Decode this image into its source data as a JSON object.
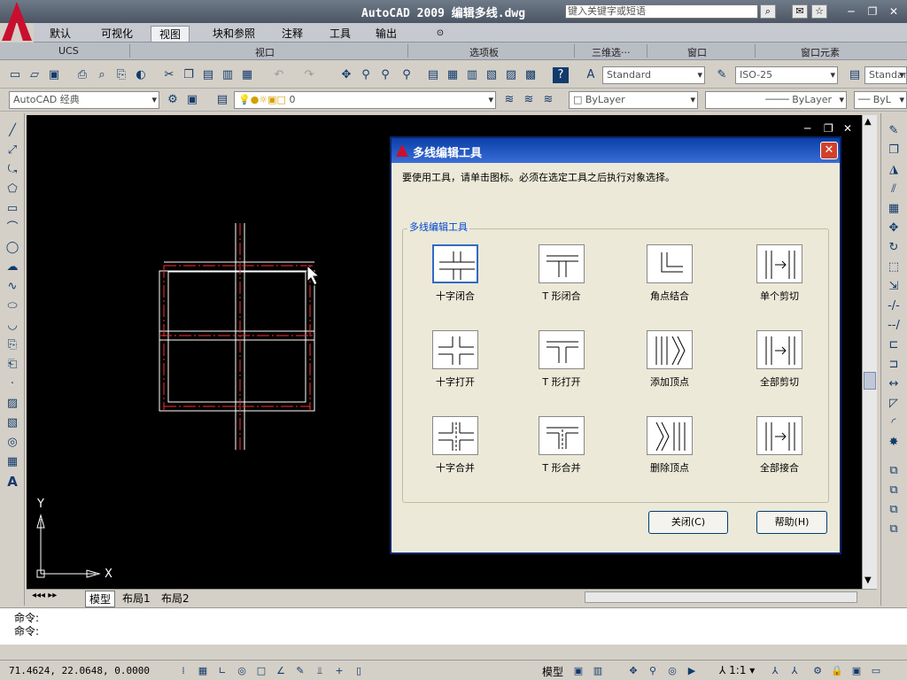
{
  "app": {
    "title": "AutoCAD 2009  编辑多线.dwg",
    "search_placeholder": "键入关键字或短语"
  },
  "ribbon": {
    "tabs": [
      {
        "label": "默认"
      },
      {
        "label": "可视化"
      },
      {
        "label": "视图"
      },
      {
        "label": "块和参照"
      },
      {
        "label": "注释"
      },
      {
        "label": "工具"
      },
      {
        "label": "输出"
      }
    ],
    "active_tab": "视图",
    "panels": [
      {
        "label": "UCS"
      },
      {
        "label": "视口"
      },
      {
        "label": "选项板"
      },
      {
        "label": "三维选···"
      },
      {
        "label": "窗口"
      },
      {
        "label": "窗口元素"
      }
    ]
  },
  "toolbar": {
    "text_style": "Standard",
    "dim_style": "ISO-25",
    "table_style": "Standar",
    "workspace": "AutoCAD 经典",
    "layer": "0",
    "color": "ByLayer",
    "linetype": "ByLayer",
    "lineweight": "ByL"
  },
  "canvas": {
    "ucs_x": "X",
    "ucs_y": "Y"
  },
  "layout_tabs": [
    {
      "label": "模型"
    },
    {
      "label": "布局1"
    },
    {
      "label": "布局2"
    }
  ],
  "command": {
    "lines": [
      "命令:",
      "命令:"
    ]
  },
  "status": {
    "coords": "71.4624, 22.0648, 0.0000",
    "model": "模型",
    "scale": "1:1"
  },
  "dialog": {
    "title": "多线编辑工具",
    "instruction": "要使用工具，请单击图标。必须在选定工具之后执行对象选择。",
    "group_label": "多线编辑工具",
    "tools": [
      {
        "label": "十字闭合"
      },
      {
        "label": "T 形闭合"
      },
      {
        "label": "角点结合"
      },
      {
        "label": "单个剪切"
      },
      {
        "label": "十字打开"
      },
      {
        "label": "T 形打开"
      },
      {
        "label": "添加顶点"
      },
      {
        "label": "全部剪切"
      },
      {
        "label": "十字合并"
      },
      {
        "label": "T 形合并"
      },
      {
        "label": "删除顶点"
      },
      {
        "label": "全部接合"
      }
    ],
    "close_label": "关闭(C)",
    "help_label": "帮助(H)"
  },
  "colors": {
    "canvas_bg": "#000000",
    "dialog_title": "#0a3fa8",
    "drawing_line": "#ffffff",
    "center_line": "#ff3030"
  }
}
